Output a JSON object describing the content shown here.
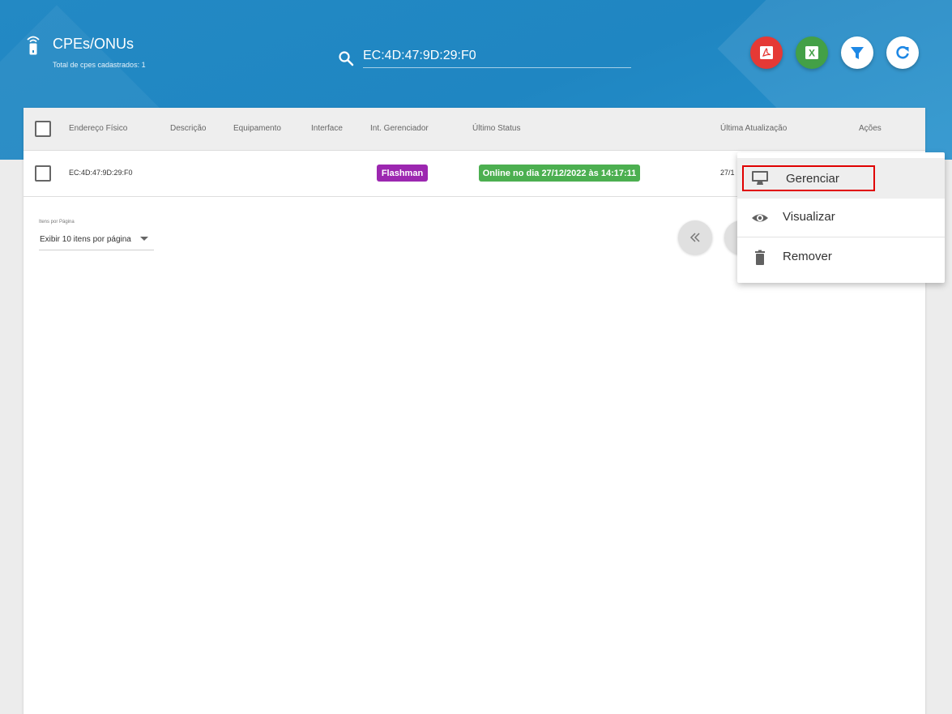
{
  "header": {
    "title": "CPEs/ONUs",
    "subtitle": "Total de cpes cadastrados: 1",
    "search_value": "EC:4D:47:9D:29:F0",
    "pdf_icon_text": "PDF",
    "excel_icon_text": "X"
  },
  "table": {
    "columns": [
      "Endereço Físico",
      "Descrição",
      "Equipamento",
      "Interface",
      "Int. Gerenciador",
      "Último Status",
      "Última Atualização",
      "Ações"
    ],
    "rows": [
      {
        "mac": "EC:4D:47:9D:29:F0",
        "description": "",
        "equipment": "",
        "interface": "",
        "manager": "Flashman",
        "status": "Online no dia 27/12/2022 às 14:17:11",
        "updated": "27/1"
      }
    ]
  },
  "pagination": {
    "label": "Itens por Página",
    "value": "Exibir 10 itens por página"
  },
  "context_menu": {
    "items": [
      {
        "label": "Gerenciar",
        "icon": "monitor-icon"
      },
      {
        "label": "Visualizar",
        "icon": "eye-icon"
      },
      {
        "label": "Remover",
        "icon": "trash-icon"
      }
    ]
  },
  "colors": {
    "header": "#2389c4",
    "pdf": "#e53935",
    "excel": "#43a047",
    "accent_blue": "#1e88e5",
    "manager_chip": "#9c27b0",
    "status_chip": "#4caf50",
    "highlight": "#e00000"
  }
}
